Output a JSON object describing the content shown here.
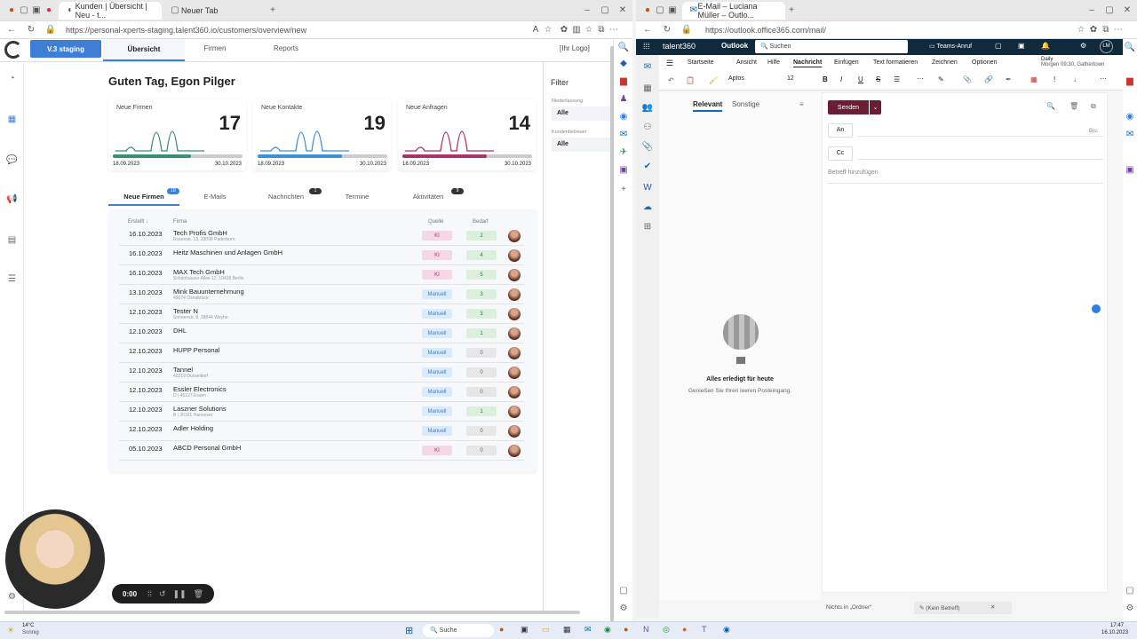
{
  "left_browser": {
    "tabs": [
      {
        "label": "Kunden | Übersicht | Neu - t..."
      },
      {
        "label": "Neuer Tab"
      }
    ],
    "url": "https://personal-xperts-staging.talent360.io/customers/overview/new"
  },
  "app": {
    "badge": "V.3 staging",
    "nav": [
      "Übersicht",
      "Firmen",
      "Reports"
    ],
    "logo": "[Ihr Logo]",
    "greeting": "Guten Tag, Egon Pilger",
    "stats": [
      {
        "label": "Neue Firmen",
        "value": "17",
        "from": "18.09.2023",
        "to": "30.10.2023",
        "color": "#3a8f6e",
        "progress": 0.6
      },
      {
        "label": "Neue Kontakte",
        "value": "19",
        "from": "18.09.2023",
        "to": "30.10.2023",
        "color": "#3d8fd6",
        "progress": 0.65
      },
      {
        "label": "Neue Anfragen",
        "value": "14",
        "from": "18.09.2023",
        "to": "30.10.2023",
        "color": "#a8336a",
        "progress": 0.65
      }
    ],
    "tabs": [
      {
        "label": "Neue Firmen",
        "count": "18"
      },
      {
        "label": "E-Mails",
        "count": ""
      },
      {
        "label": "Nachrichten",
        "count": "1"
      },
      {
        "label": "Termine",
        "count": ""
      },
      {
        "label": "Aktivitäten",
        "count": "9"
      }
    ],
    "columns": {
      "created": "Erstellt",
      "company": "Firma",
      "source": "Quelle",
      "need": "Bedarf"
    },
    "rows": [
      {
        "date": "16.10.2023",
        "company": "Tech Profis GmbH",
        "addr": "Rosenstr. 13, 33098 Paderborn",
        "source": "KI",
        "need": "2"
      },
      {
        "date": "16.10.2023",
        "company": "Heitz Maschinen und Anlagen GmbH",
        "addr": "",
        "source": "KI",
        "need": "4"
      },
      {
        "date": "16.10.2023",
        "company": "MAX Tech GmbH",
        "addr": "Schönhauser Allee 12, 10435 Berlin",
        "source": "KI",
        "need": "5"
      },
      {
        "date": "13.10.2023",
        "company": "Mink Bauunternehmung",
        "addr": "49074 Osnabrück",
        "source": "Manuell",
        "need": "3"
      },
      {
        "date": "12.10.2023",
        "company": "Tester N",
        "addr": "Sonnenstr. 8, 28844 Weyhe",
        "source": "Manuell",
        "need": "3"
      },
      {
        "date": "12.10.2023",
        "company": "DHL",
        "addr": "",
        "source": "Manuell",
        "need": "1"
      },
      {
        "date": "12.10.2023",
        "company": "HUPP Personal",
        "addr": "",
        "source": "Manuell",
        "need": "0"
      },
      {
        "date": "12.10.2023",
        "company": "Tannel",
        "addr": "40219 Düsseldorf",
        "source": "Manuell",
        "need": "0"
      },
      {
        "date": "12.10.2023",
        "company": "Essler Electronics",
        "addr": "D | 45127 Essen",
        "source": "Manuell",
        "need": "0"
      },
      {
        "date": "12.10.2023",
        "company": "Laszner Solutions",
        "addr": "B | 30161 Hannover",
        "source": "Manuell",
        "need": "1"
      },
      {
        "date": "12.10.2023",
        "company": "Adler Holding",
        "addr": "",
        "source": "Manuell",
        "need": "0"
      },
      {
        "date": "05.10.2023",
        "company": "ABCD Personal GmbH",
        "addr": "",
        "source": "KI",
        "need": "0"
      }
    ],
    "filter": {
      "title": "Filter",
      "group1": "Niederlassung",
      "value1": "Alle",
      "group2": "Kundenbetreuer",
      "value2": "Alle"
    },
    "recorder_time": "0:00"
  },
  "right_browser": {
    "tabs": [
      {
        "label": "E-Mail – Luciana Müller – Outlo..."
      }
    ],
    "url": "https://outlook.office365.com/mail/"
  },
  "outlook": {
    "brand": "talent360",
    "app": "Outlook",
    "search": "Suchen",
    "teams": "Teams-Anruf",
    "avatar": "LM",
    "ribbon": [
      "Startseite",
      "Ansicht",
      "Hilfe",
      "Nachricht",
      "Einfügen",
      "Text formatieren",
      "Zeichnen",
      "Optionen"
    ],
    "daily_title": "Daily",
    "daily_sub": "Morgen 09:30, Gathertown",
    "font": "Aptos",
    "size": "12",
    "folder_tabs": [
      "Relevant",
      "Sonstige"
    ],
    "send": "Senden",
    "to": "An",
    "cc": "Cc",
    "bcc": "Bcc",
    "subject_ph": "Betreff hinzufügen",
    "empty_title": "Alles erledigt für heute",
    "empty_sub": "Genießen Sie Ihren leeren Posteingang.",
    "status_left": "Nichts in „Ordner“",
    "draft": "(Kein Betreff)"
  },
  "taskbar": {
    "temp": "14°C",
    "weather": "Sonnig",
    "search": "Suche",
    "time": "17:47",
    "date": "16.10.2023"
  }
}
